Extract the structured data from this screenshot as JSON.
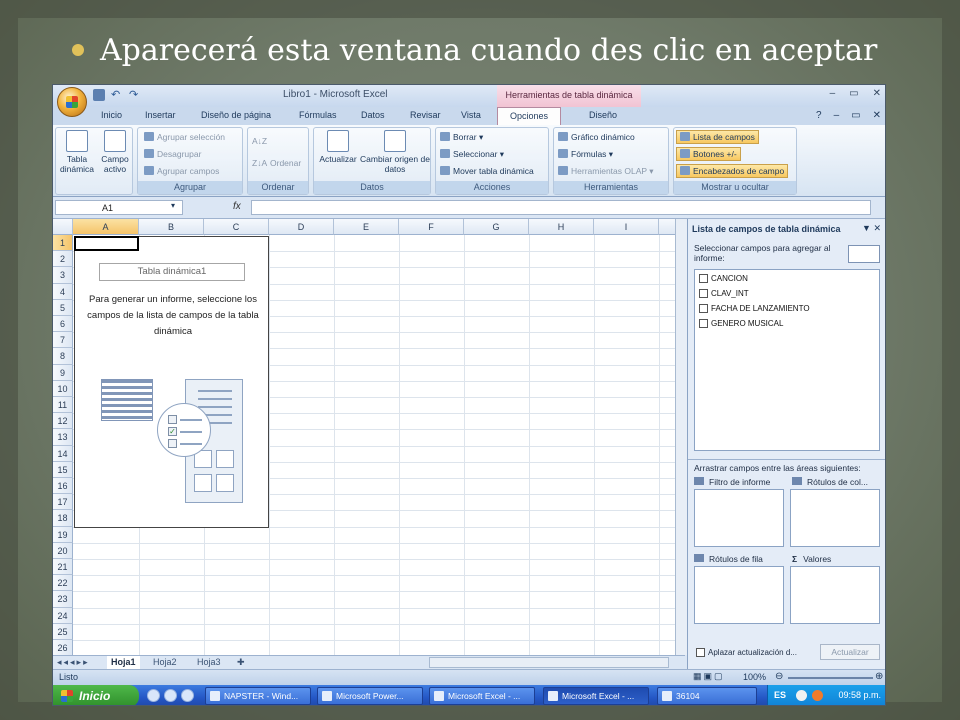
{
  "slide": {
    "title": "Aparecerá esta ventana cuando des clic en aceptar",
    "bullet_color": "#e0c15a"
  },
  "excel": {
    "window_title": "Libro1 - Microsoft Excel",
    "contextual_tools": "Herramientas de tabla dinámica",
    "tabs": [
      "Inicio",
      "Insertar",
      "Diseño de página",
      "Fórmulas",
      "Datos",
      "Revisar",
      "Vista",
      "Opciones",
      "Diseño"
    ],
    "active_tab": "Opciones",
    "ribbon": {
      "tabla_dinamica": "Tabla dinámica",
      "campo_activo": "Campo activo",
      "agrupar_seleccion": "Agrupar selección",
      "desagrupar": "Desagrupar",
      "agrupar_campos": "Agrupar campos",
      "group_agrupar": "Agrupar",
      "ordenar": "Ordenar",
      "group_ordenar": "Ordenar",
      "actualizar": "Actualizar",
      "cambiar_origen": "Cambiar origen de datos",
      "group_datos": "Datos",
      "borrar": "Borrar",
      "seleccionar": "Seleccionar",
      "mover_tabla": "Mover tabla dinámica",
      "group_acciones": "Acciones",
      "grafico_dinamico": "Gráfico dinámico",
      "formulas": "Fórmulas",
      "herramientas_olap": "Herramientas OLAP",
      "group_herramientas": "Herramientas",
      "lista_campos": "Lista de campos",
      "botones": "Botones +/-",
      "encabezados": "Encabezados de campo",
      "group_mostrar": "Mostrar u ocultar"
    },
    "name_box": "A1",
    "fx_label": "fx",
    "columns": [
      "A",
      "B",
      "C",
      "D",
      "E",
      "F",
      "G",
      "H",
      "I"
    ],
    "rows": [
      "1",
      "2",
      "3",
      "4",
      "5",
      "6",
      "7",
      "8",
      "9",
      "10",
      "11",
      "12",
      "13",
      "14",
      "15",
      "16",
      "17",
      "18",
      "19",
      "20",
      "21",
      "22",
      "23",
      "24",
      "25",
      "26"
    ],
    "pivot": {
      "name": "Tabla dinámica1",
      "instructions": "Para generar un informe, seleccione los campos de la lista de campos de la tabla dinámica"
    },
    "sheets": [
      "Hoja1",
      "Hoja2",
      "Hoja3"
    ],
    "active_sheet": "Hoja1",
    "status": "Listo",
    "zoom": "100%",
    "field_list": {
      "title": "Lista de campos de tabla dinámica",
      "instructions": "Seleccionar campos para agregar al informe:",
      "fields": [
        "CANCION",
        "CLAV_INT",
        "FACHA DE LANZAMIENTO",
        "GENERO MUSICAL"
      ],
      "areas_instructions": "Arrastrar campos entre las áreas siguientes:",
      "report_filter": "Filtro de informe",
      "column_labels": "Rótulos de col...",
      "row_labels": "Rótulos de fila",
      "values": "Valores",
      "defer_update": "Aplazar actualización d...",
      "update_button": "Actualizar"
    }
  },
  "taskbar": {
    "start": "Inicio",
    "items": [
      "NAPSTER - Wind...",
      "Microsoft Power...",
      "Microsoft Excel - ...",
      "Microsoft Excel - ...",
      "36104"
    ],
    "active_index": 3,
    "language": "ES",
    "clock": "09:58 p.m."
  }
}
